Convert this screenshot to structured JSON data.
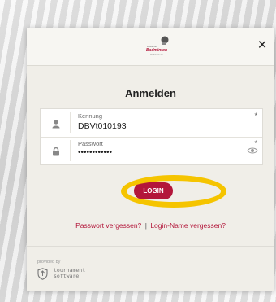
{
  "header": {
    "logo_alt": "Deutscher Badminton Verband",
    "close_glyph": "×"
  },
  "dialog": {
    "title": "Anmelden"
  },
  "fields": {
    "username": {
      "label": "Kennung",
      "value": "DBVt010193",
      "required_mark": "*",
      "icon": "user-icon"
    },
    "password": {
      "label": "Passwort",
      "value": "••••••••••••",
      "required_mark": "*",
      "icon": "lock-icon",
      "toggle_icon": "eye-icon"
    }
  },
  "login_button": {
    "label": "LOGIN",
    "color": "#b3163a"
  },
  "links": {
    "forgot_password": "Passwort vergessen?",
    "separator": "|",
    "forgot_login": "Login-Name vergessen?"
  },
  "footer": {
    "provided_by": "provided by",
    "brand_line1": "tournament",
    "brand_line2": "software"
  },
  "annotation": {
    "highlight_color": "#f5c400"
  }
}
